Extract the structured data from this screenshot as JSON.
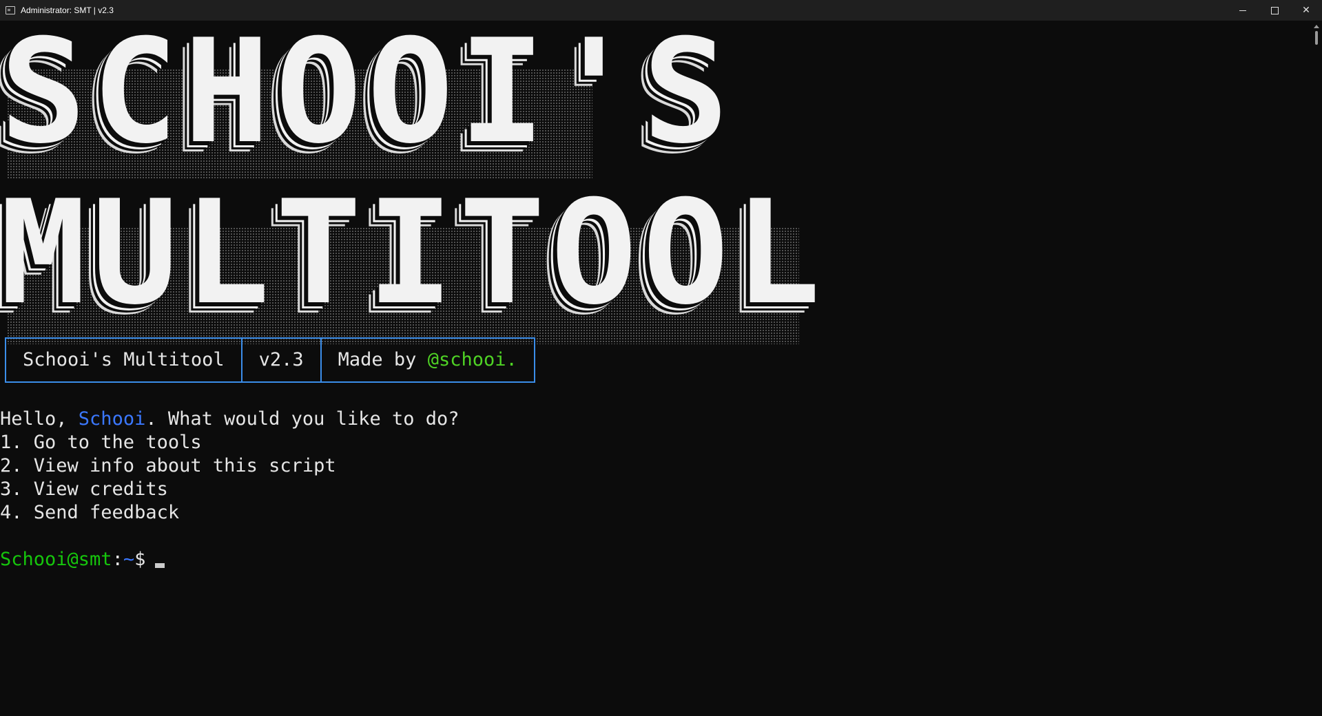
{
  "window": {
    "title": "Administrator:  SMT | v2.3",
    "controls": {
      "minimize": "minimize",
      "maximize": "maximize",
      "close": "✕"
    }
  },
  "banner": {
    "line1": "SCHOOI'S",
    "line2": "MULTITOOL"
  },
  "info": {
    "name": "Schooi's Multitool",
    "version": "v2.3",
    "made_by_prefix": "Made by ",
    "author": "@schooi."
  },
  "greeting": {
    "prefix": "Hello, ",
    "user": "Schooi",
    "suffix": ". What would you like to do?"
  },
  "menu": [
    "1. Go to the tools",
    "2. View info about this script",
    "3. View credits",
    "4. Send feedback"
  ],
  "prompt": {
    "user_host": "Schooi@smt",
    "colon": ":",
    "path": "~",
    "symbol": "$"
  },
  "colors": {
    "background": "#0c0c0c",
    "box_border": "#3b8eea",
    "prompt_green": "#16c60c",
    "username_blue": "#3b78ff",
    "author_green": "#4fd325"
  }
}
